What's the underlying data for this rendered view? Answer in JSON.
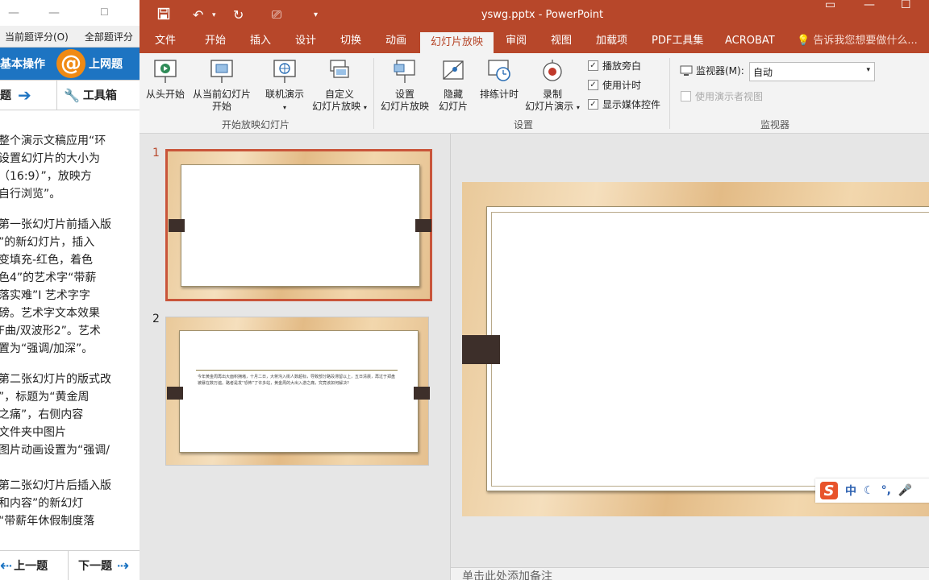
{
  "exam": {
    "score_current": "当前题评分(O)",
    "score_all": "全部题评分",
    "mode_label": "基本操作",
    "logo_glyph": "@",
    "online_label": "上网题",
    "question_label": "题",
    "toolbox_label": "工具箱",
    "paragraphs": [
      [
        "整个演示文稿应用“环",
        "设置幻灯片的大小为",
        "（16:9）”，放映方",
        "自行浏览”。"
      ],
      [
        "第一张幻灯片前插入版",
        "”的新幻灯片，插入",
        "变填充-红色，着色",
        "色4”的艺术字“带薪",
        "落实难”I 艺术字字",
        "磅。艺术字文本效果",
        "F曲/双波形2”。艺术",
        "置为“强调/加深”。"
      ],
      [
        "第二张幻灯片的版式改",
        "”，标题为“黄金周",
        "之痛”，右侧内容",
        "文件夹中图片",
        "图片动画设置为“强调/"
      ],
      [
        "第二张幻灯片后插入版",
        "和内容”的新幻灯",
        "“带薪年休假制度落"
      ]
    ],
    "prev_label": "上一题",
    "next_label": "下一题"
  },
  "ppt": {
    "title": "yswg.pptx - PowerPoint",
    "tabs": [
      "文件",
      "开始",
      "插入",
      "设计",
      "切换",
      "动画",
      "幻灯片放映",
      "审阅",
      "视图",
      "加载项",
      "PDF工具集",
      "ACROBAT"
    ],
    "active_tab": "幻灯片放映",
    "tell_me": "告诉我您想要做什么...",
    "ribbon": {
      "from_beginning": "从头开始",
      "from_current": [
        "从当前幻灯片",
        "开始"
      ],
      "present_online": "联机演示",
      "custom_show": [
        "自定义",
        "幻灯片放映"
      ],
      "group_start": "开始放映幻灯片",
      "setup_show": [
        "设置",
        "幻灯片放映"
      ],
      "hide_slide": [
        "隐藏",
        "幻灯片"
      ],
      "rehearse": "排练计时",
      "record": [
        "录制",
        "幻灯片演示"
      ],
      "play_narrations": "播放旁白",
      "use_timings": "使用计时",
      "show_media_controls": "显示媒体控件",
      "group_setup": "设置",
      "monitor_label": "监视器(M):",
      "monitor_value": "自动",
      "presenter_view": "使用演示者视图",
      "group_monitors": "监视器"
    },
    "slides": [
      {
        "number": "1",
        "selected": true
      },
      {
        "number": "2",
        "selected": false,
        "text": "今年黄金周再出大面积拥堵，十月二日，大蒋沟入街人数超标，导致部分路段滞留以上，五日清晨，再过于郑盘被暴在数万遍。路者是发“恐怖”了许多站，黄金周的大出入游之痛，究竟该如何解决?"
      }
    ],
    "notes_placeholder": "单击此处添加备注",
    "ime_text": "中"
  },
  "colors": {
    "accent": "#b7472a",
    "exam_blue": "#1d74c2"
  }
}
